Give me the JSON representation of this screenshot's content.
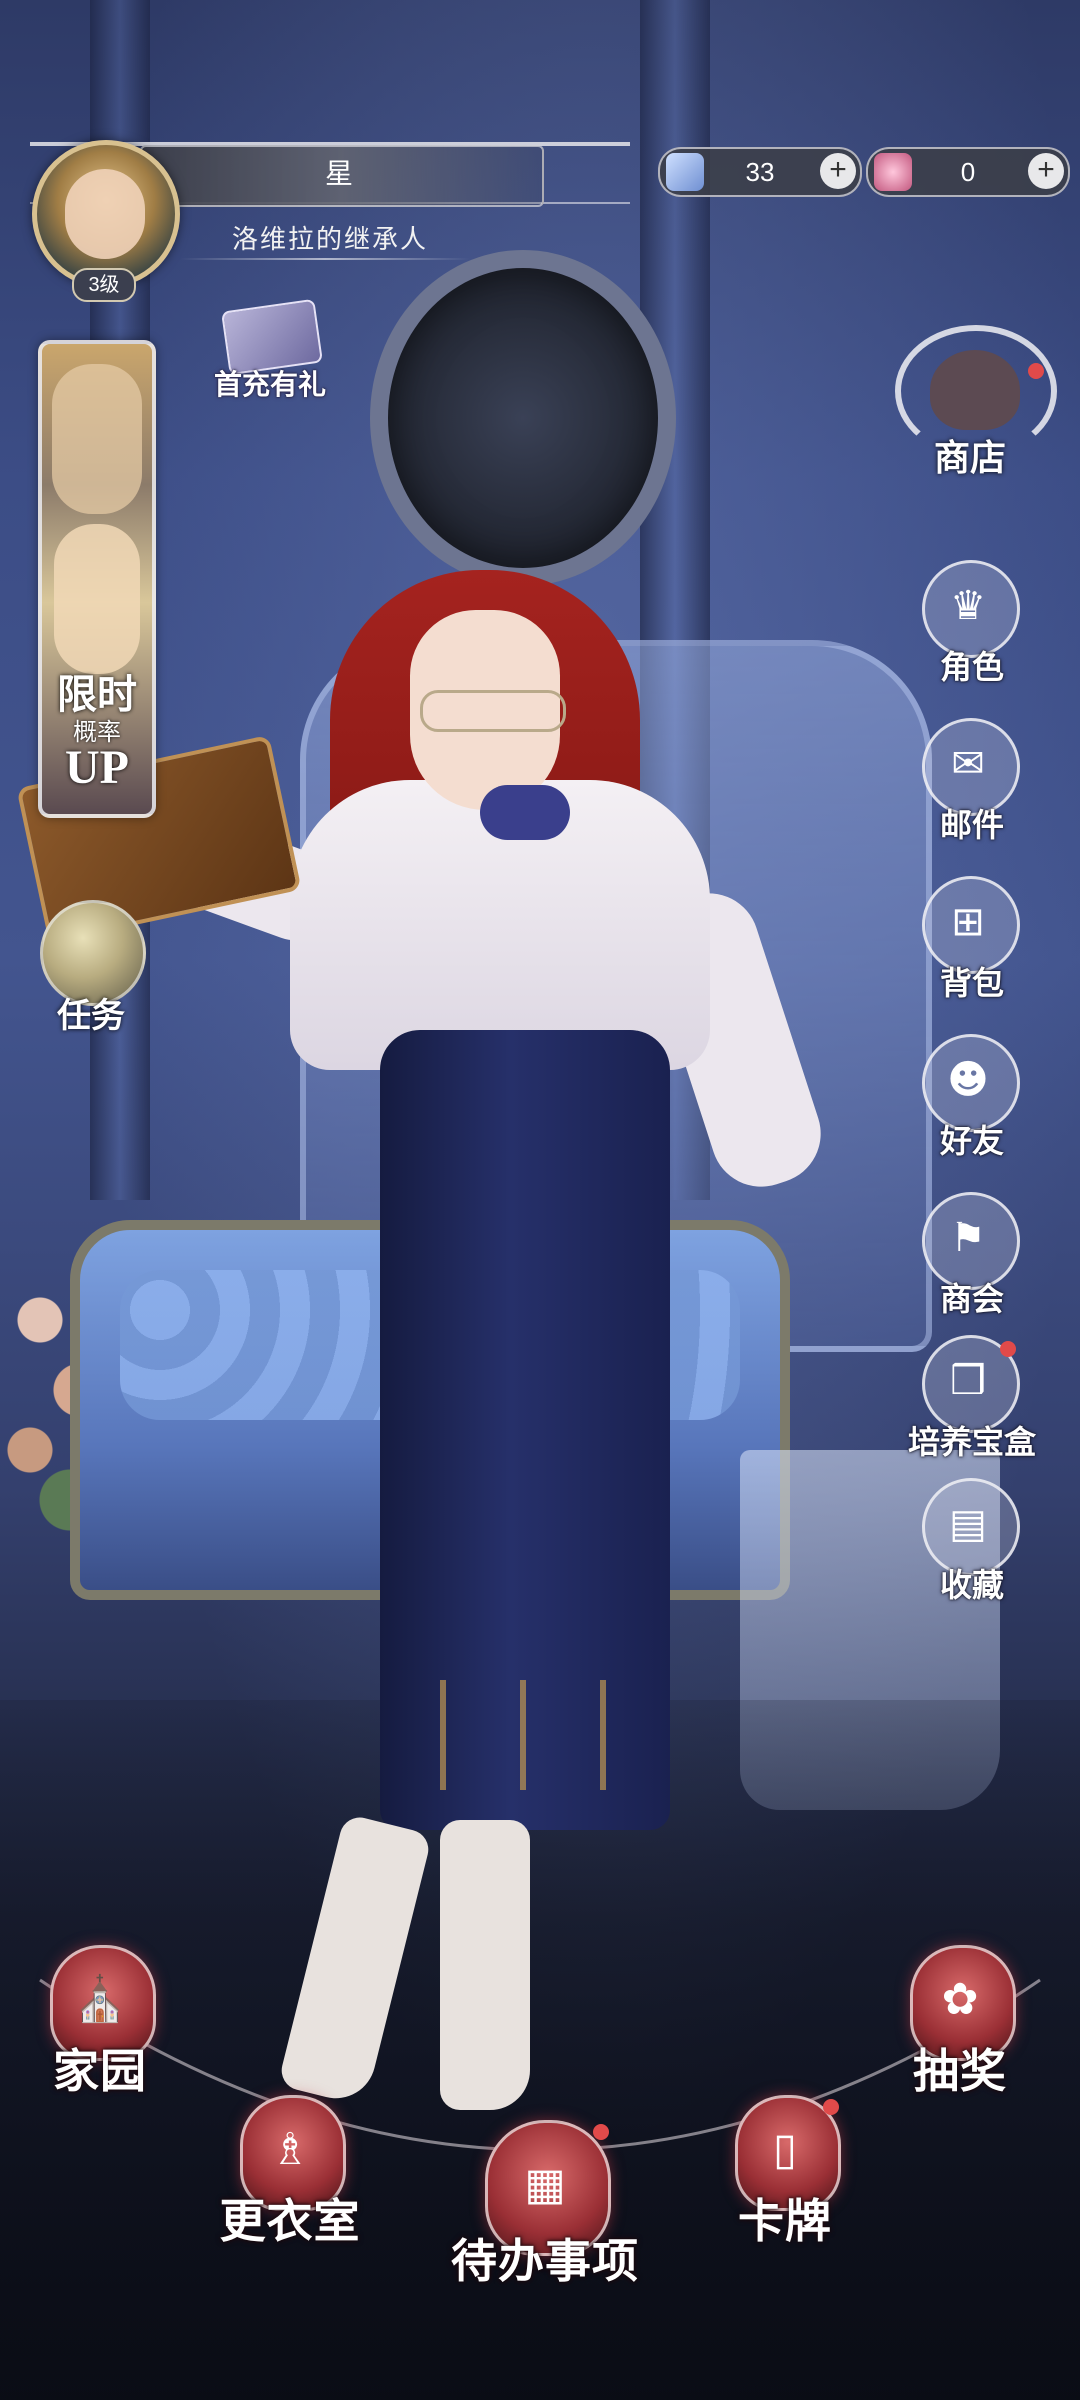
{
  "player": {
    "name": "星",
    "title": "洛维拉的继承人",
    "level": "3级"
  },
  "currencies": [
    {
      "icon": "blue-gem-icon",
      "value": "33",
      "plus": "+",
      "color": "#8fb0e6"
    },
    {
      "icon": "pink-crystal-icon",
      "value": "0",
      "plus": "+",
      "color": "#e59ab6"
    }
  ],
  "left": {
    "first_gift": "首充有礼",
    "limited_banner": {
      "line1": "限时",
      "line2": "概率",
      "line3": "UP"
    },
    "task": "任务"
  },
  "right": {
    "shop": "商店",
    "menu": [
      {
        "label": "角色",
        "icon": "top-hat-icon",
        "glyph": "♛",
        "badge": false
      },
      {
        "label": "邮件",
        "icon": "envelope-icon",
        "glyph": "✉",
        "badge": false
      },
      {
        "label": "背包",
        "icon": "bag-icon",
        "glyph": "⊞",
        "badge": false
      },
      {
        "label": "好友",
        "icon": "friends-icon",
        "glyph": "☻",
        "badge": false
      },
      {
        "label": "商会",
        "icon": "guild-banner-icon",
        "glyph": "⚑",
        "badge": false
      },
      {
        "label": "培养宝盒",
        "icon": "gift-box-icon",
        "glyph": "❒",
        "badge": true
      },
      {
        "label": "收藏",
        "icon": "book-icon",
        "glyph": "▤",
        "badge": false
      }
    ]
  },
  "bottom_nav": {
    "home": "家园",
    "wardrobe": "更衣室",
    "todo": "待办事项",
    "cards": "卡牌",
    "gacha": "抽奖"
  },
  "colors": {
    "accent_red": "#9a2f35",
    "notification": "#e14a4a",
    "background_blue": "#3c4d86"
  }
}
